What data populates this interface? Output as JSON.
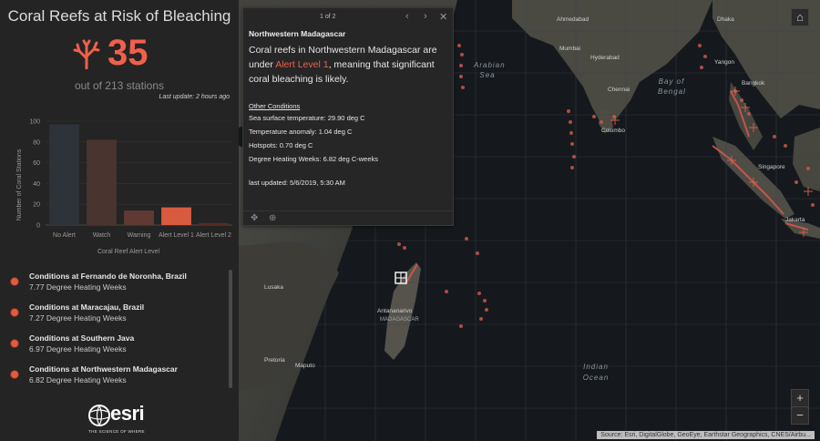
{
  "header": {
    "title": "Coral Reefs at Risk of Bleaching",
    "count": "35",
    "count_sub": "out of 213 stations",
    "last_update": "Last update: 2 hours ago"
  },
  "chart_data": {
    "type": "bar",
    "categories": [
      "No Alert",
      "Watch",
      "Warning",
      "Alert Level 1",
      "Alert Level 2"
    ],
    "values": [
      97,
      82,
      14,
      17,
      2
    ],
    "colors": [
      "#2e333a",
      "#4a3430",
      "#5e3a32",
      "#d85a3f",
      "#5a2a22"
    ],
    "xlabel": "Coral Reef Alert Level",
    "ylabel": "Number of Coral Stations",
    "ylim": [
      0,
      100
    ],
    "yticks": [
      0,
      20,
      40,
      60,
      80,
      100
    ]
  },
  "conditions": [
    {
      "title": "Conditions at Fernando de Noronha, Brazil",
      "sub": "7.77 Degree Heating Weeks"
    },
    {
      "title": "Conditions at Maracajau, Brazil",
      "sub": "7.27 Degree Heating Weeks"
    },
    {
      "title": "Conditions at Southern Java",
      "sub": "6.97 Degree Heating Weeks"
    },
    {
      "title": "Conditions at Northwestern Madagascar",
      "sub": "6.82 Degree Heating Weeks"
    }
  ],
  "esri": {
    "name": "esri",
    "tagline": "THE SCIENCE OF WHERE"
  },
  "popup": {
    "pager": "1 of 2",
    "title": "Northwestern Madagascar",
    "desc_pre": "Coral reefs in Northwestern Madagascar are under ",
    "desc_alert": "Alert Level 1",
    "desc_post": ", meaning that significant coral bleaching is likely.",
    "other_heading": "Other Conditions",
    "lines": [
      "Sea surface temperature: 29.90 deg C",
      "Temperature anomaly: 1.04 deg C",
      "Hotspots: 0.70 deg C",
      "Degree Heating Weeks: 6.82 deg C-weeks"
    ],
    "last_updated": "last updated: 5/6/2019, 5:30 AM"
  },
  "map": {
    "labels": {
      "ahmedabad": "Ahmedabad",
      "dhaka": "Dhaka",
      "mumbai": "Mumbai",
      "hyderabad": "Hyderabad",
      "yangon": "Yangon",
      "arabian_sea": "Arabian Sea",
      "bay_of_bengal": "Bay of Bengal",
      "chennai": "Chennai",
      "bangkok": "Bangkok",
      "colombo": "Colombo",
      "singapore": "Singapore",
      "jakarta": "Jakarta",
      "lusaka": "Lusaka",
      "antananarivo": "Antananarivo",
      "madagascar": "MADAGASCAR",
      "pretoria": "Pretoria",
      "maputo": "Maputo",
      "indian_ocean": "Indian Ocean"
    },
    "attribution": "Source: Esri, DigitalGlobe, GeoEye, Earthstar Geographics, CNES/Airbu...",
    "zoom_in": "+",
    "zoom_out": "−",
    "home": "⌂"
  }
}
